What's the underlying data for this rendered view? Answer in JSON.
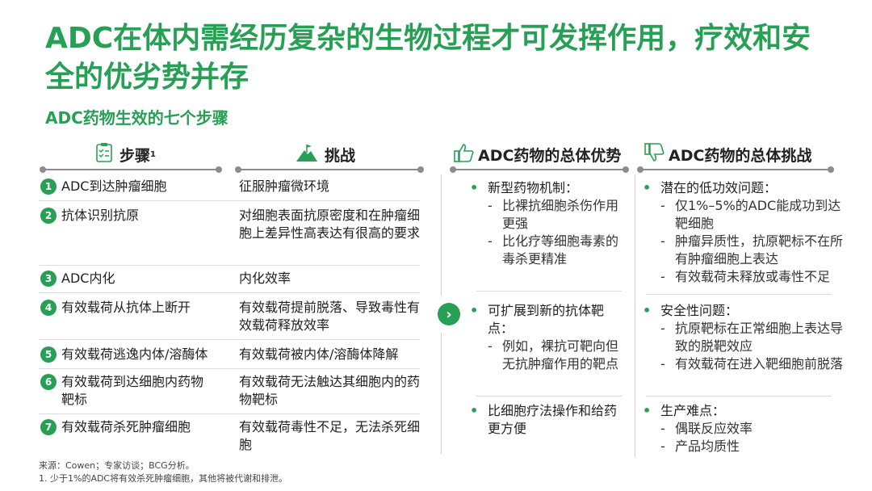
{
  "title": "ADC在体内需经历复杂的生物过程才可发挥作用，疗效和安全的优劣势并存",
  "subtitle": "ADC药物生效的七个步骤",
  "headers": {
    "steps": "步骤",
    "steps_sup": "1",
    "challenges": "挑战",
    "advantages": "ADC药物的总体优势",
    "overall_challenges": "ADC药物的总体挑战"
  },
  "rows": [
    {
      "num": "1",
      "step": "ADC到达肿瘤细胞",
      "challenge": "征服肿瘤微环境"
    },
    {
      "num": "2",
      "step": "抗体识别抗原",
      "challenge": "对细胞表面抗原密度和在肿瘤细胞上差异性高表达有很高的要求"
    },
    {
      "num": "3",
      "step": "ADC内化",
      "challenge": "内化效率"
    },
    {
      "num": "4",
      "step": "有效载荷从抗体上断开",
      "challenge": "有效载荷提前脱落、导致毒性有效载荷释放效率"
    },
    {
      "num": "5",
      "step": "有效载荷逃逸内体/溶酶体",
      "challenge": "有效载荷被内体/溶酶体降解"
    },
    {
      "num": "6",
      "step": "有效载荷到达细胞内药物靶标",
      "challenge": "有效载荷无法触达其细胞内的药物靶标"
    },
    {
      "num": "7",
      "step": "有效载荷杀死肿瘤细胞",
      "challenge": "有效载荷毒性不足，无法杀死细胞"
    }
  ],
  "advantages": [
    {
      "text": "新型药物机制：",
      "subs": [
        "比裸抗细胞杀伤作用更强",
        "比化疗等细胞毒素的毒杀更精准"
      ]
    },
    {
      "text": "可扩展到新的抗体靶点：",
      "subs": [
        "例如，裸抗可靶向但无抗肿瘤作用的靶点"
      ]
    },
    {
      "text": "比细胞疗法操作和给药更方便",
      "subs": []
    }
  ],
  "overall_challenges": [
    {
      "text": "潜在的低功效问题：",
      "subs": [
        "仅1%–5%的ADC能成功到达靶细胞",
        "肿瘤异质性，抗原靶标不在所有肿瘤细胞上表达",
        "有效载荷未释放或毒性不足"
      ]
    },
    {
      "text": "安全性问题：",
      "subs": [
        "抗原靶标在正常细胞上表达导致的脱靶效应",
        "有效载荷在进入靶细胞前脱落"
      ]
    },
    {
      "text": "生产难点：",
      "subs": [
        "偶联反应效率",
        "产品均质性"
      ]
    }
  ],
  "footnotes": {
    "source": "来源：Cowen；专家访谈；BCG分析。",
    "note": "1. 少于1%的ADC将有效杀死肿瘤细胞，其他将被代谢和排泄。"
  },
  "colors": {
    "accent": "#27a055"
  },
  "icons": [
    "checklist-icon",
    "mountain-flag-icon",
    "thumbs-up-icon",
    "thumbs-down-icon",
    "chevron-right-icon"
  ]
}
